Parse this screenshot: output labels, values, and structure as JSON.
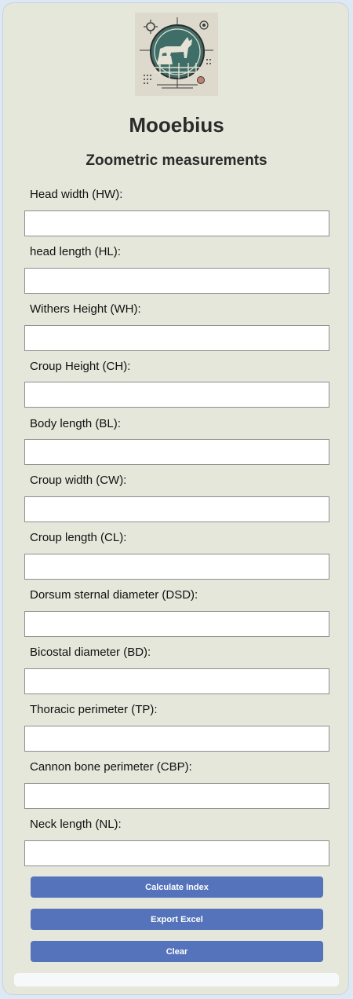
{
  "app": {
    "title": "Mooebius",
    "subtitle": "Zoometric measurements"
  },
  "fields": [
    {
      "label": "Head width (HW):",
      "value": "",
      "placeholder": ""
    },
    {
      "label": "head length (HL):",
      "value": "",
      "placeholder": ""
    },
    {
      "label": "Withers Height (WH):",
      "value": "",
      "placeholder": ""
    },
    {
      "label": "Croup Height (CH):",
      "value": "",
      "placeholder": ""
    },
    {
      "label": "Body length (BL):",
      "value": "",
      "placeholder": ""
    },
    {
      "label": "Croup width (CW):",
      "value": "",
      "placeholder": ""
    },
    {
      "label": "Croup length (CL):",
      "value": "",
      "placeholder": ""
    },
    {
      "label": "Dorsum sternal diameter (DSD):",
      "value": "",
      "placeholder": ""
    },
    {
      "label": "Bicostal diameter (BD):",
      "value": "",
      "placeholder": ""
    },
    {
      "label": "Thoracic perimeter (TP):",
      "value": "",
      "placeholder": ""
    },
    {
      "label": "Cannon bone perimeter (CBP):",
      "value": "",
      "placeholder": ""
    },
    {
      "label": "Neck length (NL):",
      "value": "",
      "placeholder": ""
    }
  ],
  "buttons": {
    "calculate": "Calculate Index",
    "export": "Export Excel",
    "clear": "Clear"
  },
  "logo": {
    "icon": "cattle-emblem-icon"
  },
  "colors": {
    "button": "#5473bb",
    "card": "#e4e7da",
    "page": "#dce8f3",
    "logo_circle": "#3f6e68"
  }
}
